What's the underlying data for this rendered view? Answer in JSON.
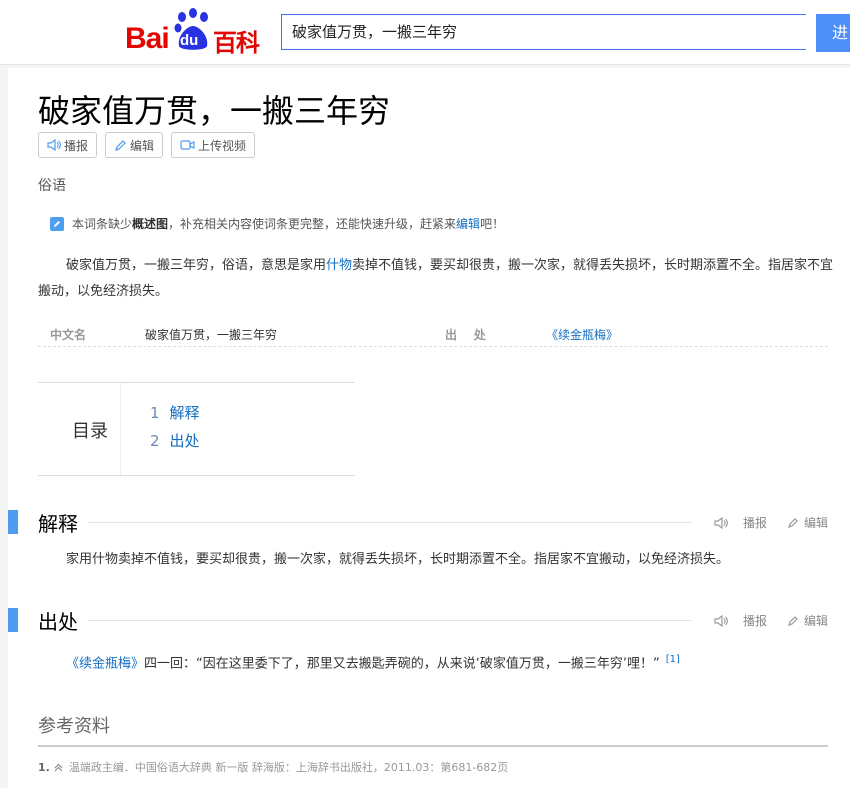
{
  "header": {
    "logo_bai": "Bai",
    "logo_du": "du",
    "logo_baike": "百科",
    "search_value": "破家值万贯，一搬三年穷",
    "search_button": "进"
  },
  "article": {
    "title": "破家值万贯，一搬三年穷",
    "buttons": {
      "play": "播报",
      "edit": "编辑",
      "upload_video": "上传视频"
    },
    "category": "俗语",
    "notice": {
      "prefix": "本词条缺少",
      "bold": "概述图",
      "middle": "，补充相关内容使词条更完整，还能快速升级，赶紧来",
      "link": "编辑",
      "suffix": "吧！"
    },
    "summary": {
      "part1": "破家值万贯，一搬三年穷，俗语，意思是家用",
      "link": "什物",
      "part2": "卖掉不值钱，要买却很贵，搬一次家，就得丢失损坏，长时期添置不全。指居家不宜搬动，以免经济损失。"
    },
    "basic_info": {
      "key1": "中文名",
      "value1": "破家值万贯，一搬三年穷",
      "key2": "出    处",
      "value2": "《续金瓶梅》"
    }
  },
  "catalog": {
    "title": "目录",
    "items": [
      {
        "num": "1",
        "label": "解释"
      },
      {
        "num": "2",
        "label": "出处"
      }
    ]
  },
  "sections": {
    "play": "播报",
    "edit": "编辑",
    "explain": {
      "title": "解释",
      "text": "家用什物卖掉不值钱，要买却很贵，搬一次家，就得丢失损坏，长时期添置不全。指居家不宜搬动，以免经济损失。"
    },
    "source": {
      "title": "出处",
      "link": "《续金瓶梅》",
      "text": "四一回：“因在这里委下了，那里又去搬匙弄碗的，从来说‘破家值万贯，一搬三年穷’哩！”",
      "ref": "[1]"
    }
  },
  "references": {
    "title": "参考资料",
    "items": [
      {
        "num": "1.",
        "text": "温端政主编．中国俗语大辞典 新一版 辞海版：上海辞书出版社，2011.03：第681-682页"
      }
    ]
  },
  "colors": {
    "accent": "#4f9cee",
    "link": "#136ec2",
    "brand_red": "#e10602",
    "brand_blue": "#2932e1"
  }
}
